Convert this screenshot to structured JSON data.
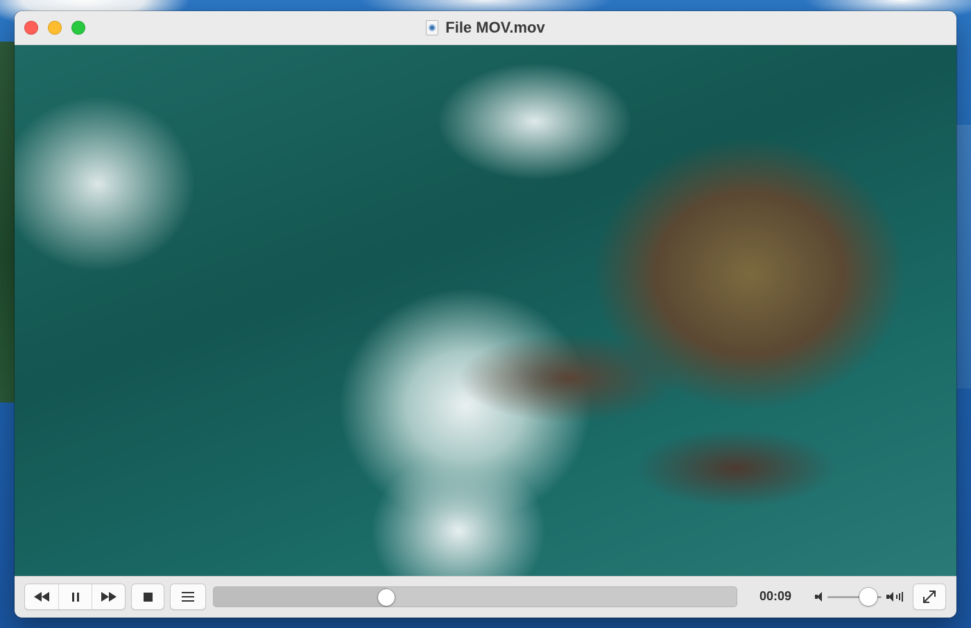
{
  "window": {
    "title": "File MOV.mov",
    "file_icon": "quicktime-document-icon"
  },
  "video": {
    "description_hidden": ""
  },
  "controls": {
    "rewind_icon": "rewind-icon",
    "pause_icon": "pause-icon",
    "fast_forward_icon": "fast-forward-icon",
    "stop_icon": "stop-icon",
    "playlist_icon": "playlist-icon",
    "progress_fraction": 0.33,
    "elapsed_time": "00:09",
    "volume_fraction": 0.75,
    "fullscreen_icon": "fullscreen-icon"
  },
  "colors": {
    "close": "#ff5f57",
    "minimize": "#febc2e",
    "maximize": "#28c840"
  }
}
